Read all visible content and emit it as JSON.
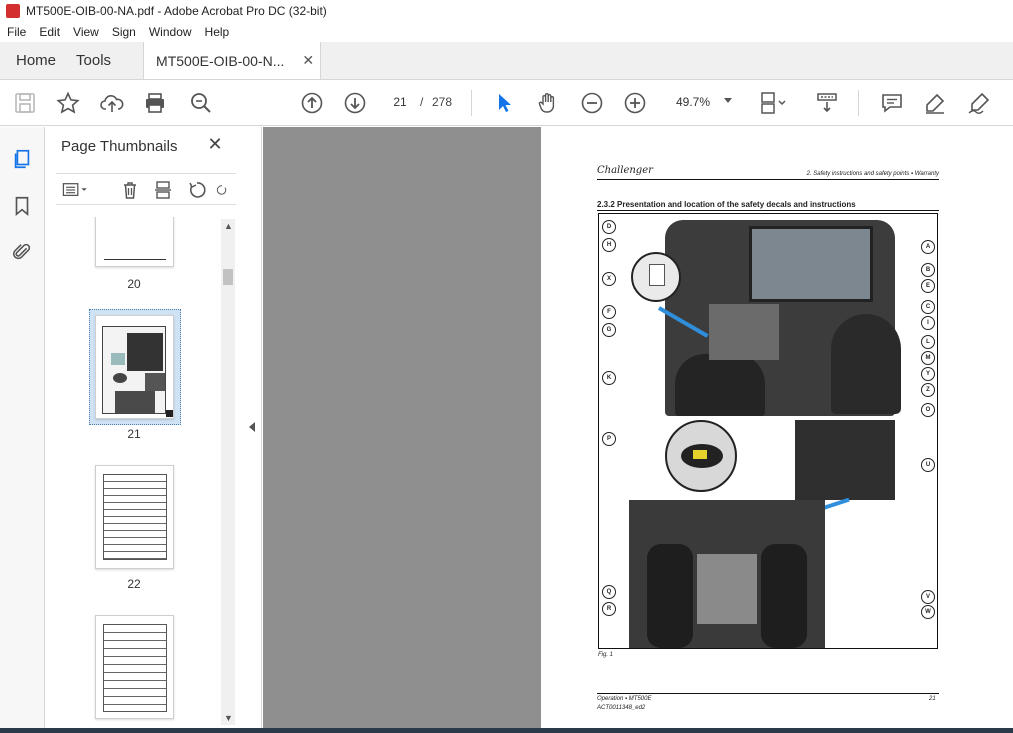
{
  "window": {
    "title": "MT500E-OIB-00-NA.pdf - Adobe Acrobat Pro DC (32-bit)"
  },
  "menu": [
    "File",
    "Edit",
    "View",
    "Sign",
    "Window",
    "Help"
  ],
  "tabs": {
    "home": "Home",
    "tools": "Tools",
    "document": "MT500E-OIB-00-N...",
    "close": "✕"
  },
  "toolbar": {
    "current_page": "21",
    "page_separator": "/",
    "total_pages": "278",
    "zoom": "49.7%",
    "icons": [
      "save-icon",
      "star-icon",
      "upload-icon",
      "print-icon",
      "zoom-search-icon",
      "page-up-icon",
      "page-down-icon",
      "select-arrow-icon",
      "hand-icon",
      "zoom-out-icon",
      "zoom-in-icon",
      "zoom-dropdown",
      "page-layout-icon",
      "scroll-mode-icon",
      "comment-icon",
      "highlight-icon",
      "sign-icon"
    ]
  },
  "rail": [
    "pages-icon",
    "bookmark-icon",
    "attachment-icon"
  ],
  "panel": {
    "title": "Page Thumbnails",
    "close": "✕",
    "thumbnails": [
      {
        "label": "20"
      },
      {
        "label": "21"
      },
      {
        "label": "22"
      },
      {
        "label": ""
      }
    ]
  },
  "page": {
    "brand": "Challenger",
    "header": "2. Safety instructions and safety points ▪ Warranty",
    "section": "2.3.2  Presentation and location of the safety decals and instructions",
    "callouts_left": [
      "D",
      "H",
      "X",
      "F",
      "G",
      "K",
      "P",
      "Q",
      "R"
    ],
    "callouts_right": [
      "A",
      "B",
      "E",
      "C",
      "I",
      "L",
      "M",
      "Y",
      "Z",
      "O",
      "U",
      "V",
      "W"
    ],
    "figure_caption": "Fig. 1",
    "footer_line1": "Operation ▪ MT500E",
    "footer_line2": "ACT0011348_ed2",
    "page_number": "21"
  },
  "colors": {
    "accent": "#1473e6",
    "rail_bg": "#f7f7f7",
    "doc_bg": "#8f8f8f"
  }
}
